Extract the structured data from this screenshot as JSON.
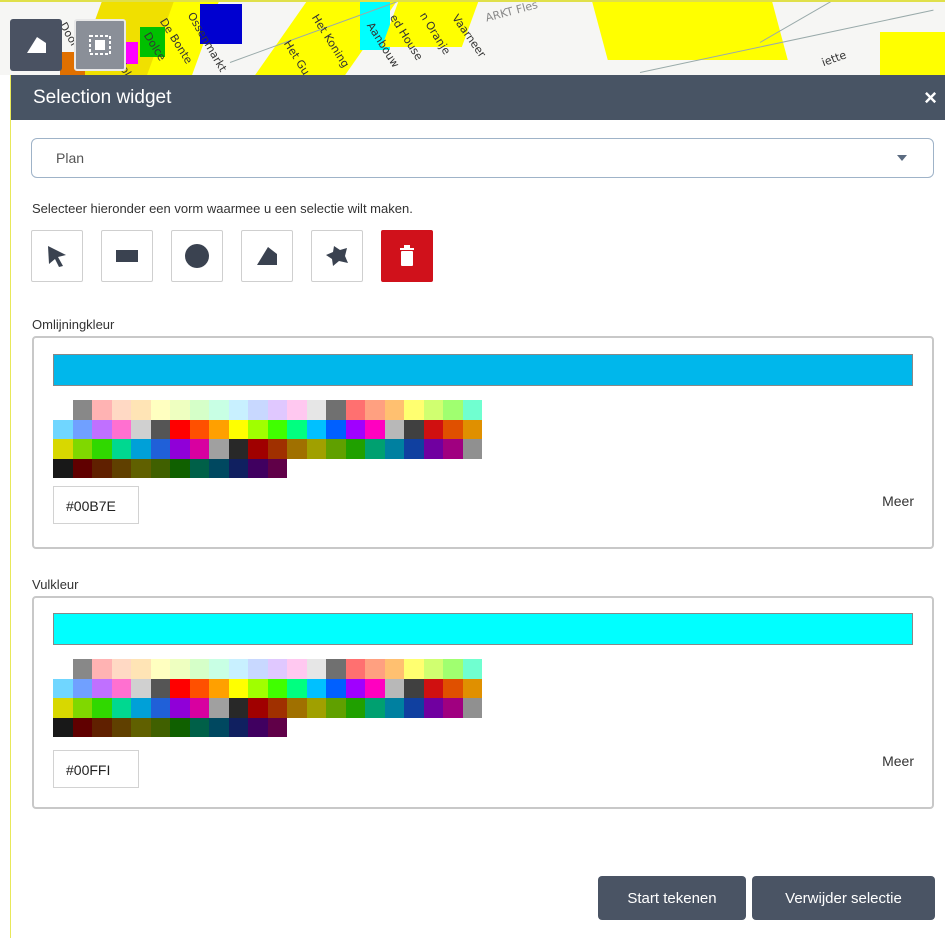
{
  "map": {
    "streets": [
      "Door",
      "De Bonte",
      "Dolce",
      "Zol",
      "Ossenmarkt",
      "Het Gu",
      "Het Koning",
      "Aanbouw",
      "ed House",
      "n Oranje",
      "Vaarneer",
      "ARKT Fles",
      "iette"
    ]
  },
  "widget": {
    "title": "Selection widget",
    "close_label": "×",
    "dropdown": {
      "selected": "Plan"
    },
    "instruction": "Selecteer hieronder een vorm waarmee u een selectie wilt maken.",
    "tools": [
      {
        "name": "pointer-tool",
        "icon": "pointer-arrow-icon"
      },
      {
        "name": "rectangle-tool",
        "icon": "rectangle-icon"
      },
      {
        "name": "circle-tool",
        "icon": "circle-icon"
      },
      {
        "name": "polygon-tool",
        "icon": "polygon-icon"
      },
      {
        "name": "freehand-tool",
        "icon": "freehand-polygon-icon"
      },
      {
        "name": "delete-tool",
        "icon": "trash-icon"
      }
    ],
    "outline": {
      "label": "Omlijningkleur",
      "hex_value": "#00B7E",
      "color": "#00B7EB",
      "more_label": "Meer"
    },
    "fill": {
      "label": "Vulkleur",
      "hex_value": "#00FFI",
      "color": "#00FFFF",
      "more_label": "Meer"
    },
    "palette_rows": [
      [
        "#ffffff",
        "#888888",
        "#ffb3b3",
        "#ffd9c4",
        "#ffe4b5",
        "#ffffc0",
        "#eeffc0",
        "#d5ffc8",
        "#c8ffe4",
        "#c8f0ff",
        "#c8d8ff",
        "#e0c8ff",
        "#ffc8f0",
        "#e6e6e6",
        "#707070",
        "#ff7070",
        "#ffa080",
        "#ffc070",
        "#ffff70",
        "#d0ff70",
        "#a0ff70",
        "#70ffd0"
      ],
      [
        "#70d6ff",
        "#70a0ff",
        "#c070ff",
        "#ff70d0",
        "#d0d0d0",
        "#555555",
        "#ff0000",
        "#ff5000",
        "#ffa000",
        "#ffff00",
        "#a0ff00",
        "#40ff00",
        "#00ff80",
        "#00c0ff",
        "#0060ff",
        "#a000ff",
        "#ff00c0",
        "#b8b8b8",
        "#404040",
        "#d01010",
        "#e05000",
        "#e09000"
      ],
      [
        "#d8d800",
        "#80d800",
        "#30d800",
        "#00d890",
        "#00a0d8",
        "#2060d8",
        "#9000d8",
        "#d800a0",
        "#a0a0a0",
        "#282828",
        "#a00000",
        "#a03000",
        "#a07000",
        "#a0a000",
        "#60a000",
        "#20a000",
        "#00a070",
        "#0080a0",
        "#1040a0",
        "#7000a0",
        "#a00080",
        "#909090"
      ],
      [
        "#181818",
        "#600000",
        "#602000",
        "#604000",
        "#606000",
        "#406000",
        "#106000",
        "#006048",
        "#004860",
        "#102060",
        "#400060",
        "#600048"
      ]
    ],
    "buttons": {
      "start": "Start tekenen",
      "remove": "Verwijder selectie"
    }
  }
}
